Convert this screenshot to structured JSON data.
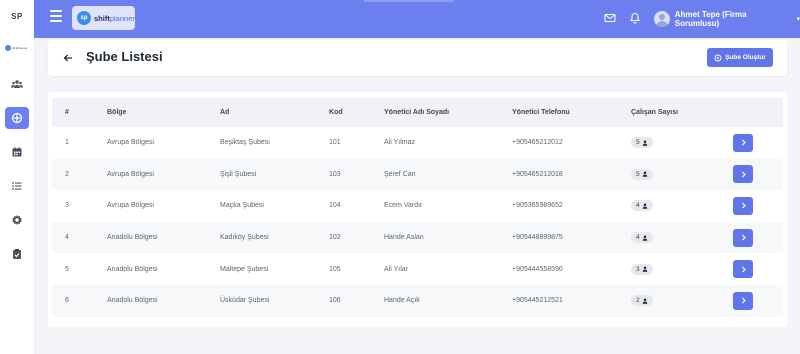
{
  "sidebar": {
    "initials": "SP",
    "logo_text": "shiftplanner",
    "items": [
      {
        "name": "users-icon",
        "active": false
      },
      {
        "name": "branch-icon",
        "active": true
      },
      {
        "name": "calendar-icon",
        "active": false
      },
      {
        "name": "list-icon",
        "active": false
      },
      {
        "name": "settings-icon",
        "active": false
      },
      {
        "name": "clipboard-icon",
        "active": false
      }
    ]
  },
  "topbar": {
    "brand_sp": "sp",
    "brand_shift": "shift",
    "brand_planner": "planner",
    "user_name": "Ahmet Tepe (Firma Sorumlusu)",
    "icons": [
      "mail-icon",
      "bell-icon"
    ]
  },
  "header": {
    "title": "Şube Listesi",
    "create_label": "Şube Oluştur"
  },
  "table": {
    "columns": [
      "#",
      "Bölge",
      "Ad",
      "Kod",
      "Yönetici Adı Soyadı",
      "Yönetici Telefonu",
      "Çalışan Sayısı",
      ""
    ],
    "rows": [
      {
        "no": "1",
        "region": "Avrupa Bölgesi",
        "name": "Beşiktaş Şubesi",
        "code": "101",
        "manager": "Ali Yılmaz",
        "phone": "+905465212012",
        "employees": "5"
      },
      {
        "no": "2",
        "region": "Avrupa Bölgesi",
        "name": "Şişli Şubesi",
        "code": "103",
        "manager": "Şeref Can",
        "phone": "+905465212018",
        "employees": "5"
      },
      {
        "no": "3",
        "region": "Avrupa Bölgesi",
        "name": "Maçka Şubesi",
        "code": "104",
        "manager": "Ecem Vardır",
        "phone": "+905365989652",
        "employees": "4"
      },
      {
        "no": "4",
        "region": "Anadolu Bölgesi",
        "name": "Kadıköy Şubesi",
        "code": "102",
        "manager": "Hande Aslan",
        "phone": "+905448899875",
        "employees": "4"
      },
      {
        "no": "5",
        "region": "Anadolu Bölgesi",
        "name": "Maltepe Şubesi",
        "code": "105",
        "manager": "Ali Yılar",
        "phone": "+905444558590",
        "employees": "3"
      },
      {
        "no": "6",
        "region": "Anadolu Bölgesi",
        "name": "Üsküdar Şubesi",
        "code": "106",
        "manager": "Hande Açık",
        "phone": "+905445212521",
        "employees": "2"
      }
    ]
  },
  "colors": {
    "primary": "#6b80ee",
    "button": "#5f75e8",
    "background": "#f4f5f9"
  }
}
